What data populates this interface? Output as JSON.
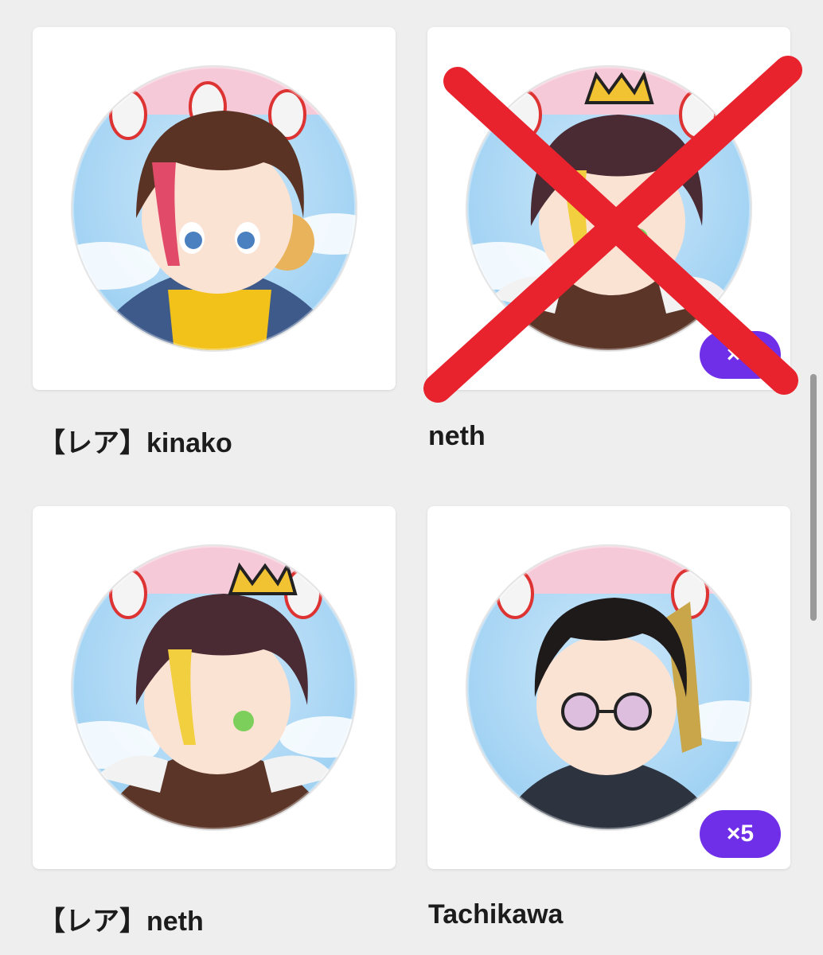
{
  "items": [
    {
      "label": "【レア】kinako",
      "character": "kinako",
      "count": null,
      "crossed_out": false
    },
    {
      "label": "neth",
      "character": "neth",
      "count": "×5",
      "crossed_out": true
    },
    {
      "label": "【レア】neth",
      "character": "neth",
      "count": null,
      "crossed_out": false
    },
    {
      "label": "Tachikawa",
      "character": "tachikawa",
      "count": "×5",
      "crossed_out": false
    }
  ],
  "colors": {
    "background": "#eeeeee",
    "card": "#ffffff",
    "count_badge": "#6f2fe8",
    "cross_mark": "#e8232d",
    "label_text": "#1c1c1c"
  }
}
